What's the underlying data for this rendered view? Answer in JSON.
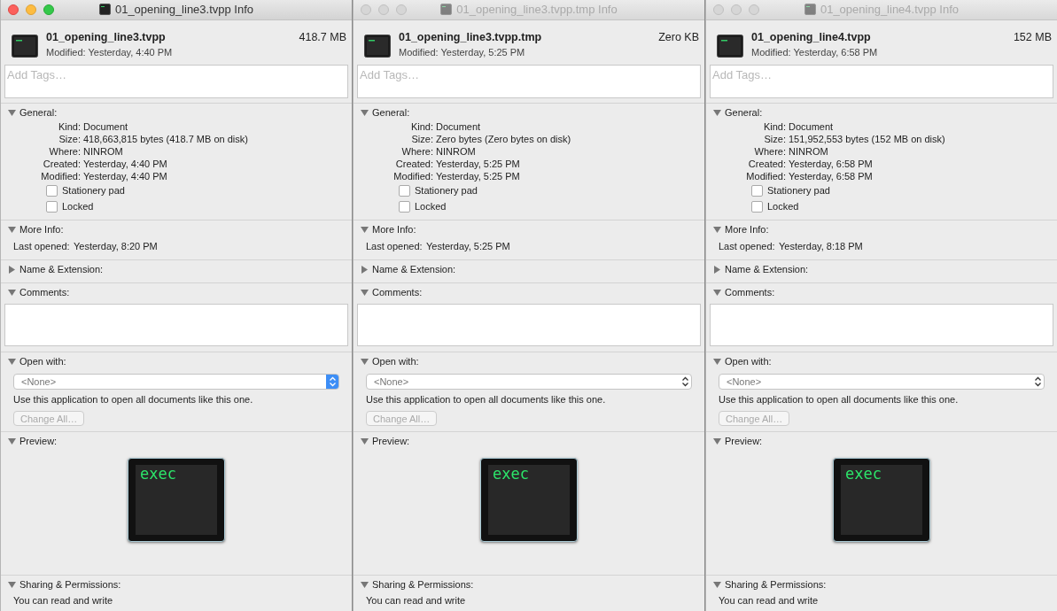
{
  "windows": [
    {
      "title": "01_opening_line3.tvpp Info",
      "active": true,
      "name": "01_opening_line3.tvpp",
      "size": "418.7 MB",
      "modified": "Modified: Yesterday, 4:40 PM",
      "tags_placeholder": "Add Tags…",
      "sections": [
        {
          "kind": "general",
          "title": "General:",
          "expanded": true,
          "rows": [
            {
              "label": "Kind:",
              "value": "Document"
            },
            {
              "label": "Size:",
              "value": "418,663,815 bytes (418.7 MB on disk)"
            },
            {
              "label": "Where:",
              "value": "NINROM"
            },
            {
              "label": "Created:",
              "value": "Yesterday, 4:40 PM"
            },
            {
              "label": "Modified:",
              "value": "Yesterday, 4:40 PM"
            }
          ],
          "checkboxes": [
            {
              "label": "Stationery pad",
              "checked": false
            },
            {
              "label": "Locked",
              "checked": false
            }
          ]
        },
        {
          "kind": "info",
          "title": "More Info:",
          "expanded": true,
          "rows": [
            {
              "label": "Last opened:",
              "value": "Yesterday, 8:20 PM"
            }
          ]
        },
        {
          "kind": "plain",
          "title": "Name & Extension:",
          "expanded": false
        },
        {
          "kind": "comments",
          "title": "Comments:",
          "expanded": true
        },
        {
          "kind": "open_with",
          "title": "Open with:",
          "expanded": true,
          "popup": "<None>",
          "note": "Use this application to open all documents like this one.",
          "button": "Change All…",
          "button_disabled": true
        },
        {
          "kind": "preview",
          "title": "Preview:",
          "expanded": true,
          "icon_text": "exec"
        },
        {
          "kind": "sharing",
          "title": "Sharing & Permissions:",
          "expanded": true,
          "text": "You can read and write"
        }
      ]
    },
    {
      "title": "01_opening_line3.tvpp.tmp Info",
      "active": false,
      "name": "01_opening_line3.tvpp.tmp",
      "size": "Zero KB",
      "modified": "Modified: Yesterday, 5:25 PM",
      "tags_placeholder": "Add Tags…",
      "sections": [
        {
          "kind": "general",
          "title": "General:",
          "expanded": true,
          "rows": [
            {
              "label": "Kind:",
              "value": "Document"
            },
            {
              "label": "Size:",
              "value": "Zero bytes (Zero bytes on disk)"
            },
            {
              "label": "Where:",
              "value": "NINROM"
            },
            {
              "label": "Created:",
              "value": "Yesterday, 5:25 PM"
            },
            {
              "label": "Modified:",
              "value": "Yesterday, 5:25 PM"
            }
          ],
          "checkboxes": [
            {
              "label": "Stationery pad",
              "checked": false
            },
            {
              "label": "Locked",
              "checked": false
            }
          ]
        },
        {
          "kind": "info",
          "title": "More Info:",
          "expanded": true,
          "rows": [
            {
              "label": "Last opened:",
              "value": "Yesterday, 5:25 PM"
            }
          ]
        },
        {
          "kind": "plain",
          "title": "Name & Extension:",
          "expanded": false
        },
        {
          "kind": "comments",
          "title": "Comments:",
          "expanded": true
        },
        {
          "kind": "open_with",
          "title": "Open with:",
          "expanded": true,
          "popup": "<None>",
          "note": "Use this application to open all documents like this one.",
          "button": "Change All…",
          "button_disabled": true
        },
        {
          "kind": "preview",
          "title": "Preview:",
          "expanded": true,
          "icon_text": "exec"
        },
        {
          "kind": "sharing",
          "title": "Sharing & Permissions:",
          "expanded": true,
          "text": "You can read and write"
        }
      ]
    },
    {
      "title": "01_opening_line4.tvpp Info",
      "active": false,
      "name": "01_opening_line4.tvpp",
      "size": "152 MB",
      "modified": "Modified: Yesterday, 6:58 PM",
      "tags_placeholder": "Add Tags…",
      "sections": [
        {
          "kind": "general",
          "title": "General:",
          "expanded": true,
          "rows": [
            {
              "label": "Kind:",
              "value": "Document"
            },
            {
              "label": "Size:",
              "value": "151,952,553 bytes (152 MB on disk)"
            },
            {
              "label": "Where:",
              "value": "NINROM"
            },
            {
              "label": "Created:",
              "value": "Yesterday, 6:58 PM"
            },
            {
              "label": "Modified:",
              "value": "Yesterday, 6:58 PM"
            }
          ],
          "checkboxes": [
            {
              "label": "Stationery pad",
              "checked": false
            },
            {
              "label": "Locked",
              "checked": false
            }
          ]
        },
        {
          "kind": "info",
          "title": "More Info:",
          "expanded": true,
          "rows": [
            {
              "label": "Last opened:",
              "value": "Yesterday, 8:18 PM"
            }
          ]
        },
        {
          "kind": "plain",
          "title": "Name & Extension:",
          "expanded": false
        },
        {
          "kind": "comments",
          "title": "Comments:",
          "expanded": true
        },
        {
          "kind": "open_with",
          "title": "Open with:",
          "expanded": true,
          "popup": "<None>",
          "note": "Use this application to open all documents like this one.",
          "button": "Change All…",
          "button_disabled": true
        },
        {
          "kind": "preview",
          "title": "Preview:",
          "expanded": true,
          "icon_text": "exec"
        },
        {
          "kind": "sharing",
          "title": "Sharing & Permissions:",
          "expanded": true,
          "text": "You can read and write"
        }
      ]
    }
  ]
}
